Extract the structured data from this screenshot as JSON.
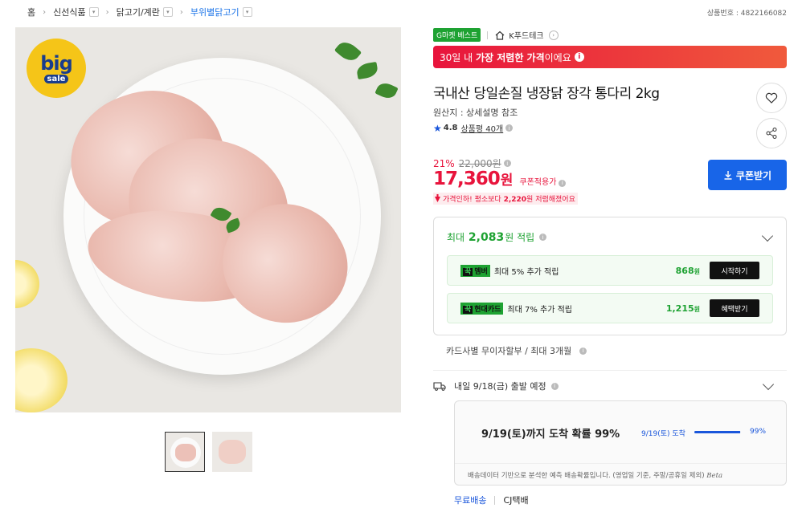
{
  "breadcrumb": [
    {
      "label": "홈"
    },
    {
      "label": "신선식품"
    },
    {
      "label": "닭고기/계란"
    },
    {
      "label": "부위별닭고기"
    }
  ],
  "product_no": "상품번호 : 4822166082",
  "gallery": {
    "badge_big": "big",
    "badge_sale": "sale",
    "thumbnail_count": 2
  },
  "seller": {
    "best_badge": "G마켓 베스트",
    "name": "K푸드테크"
  },
  "lowest_price": {
    "prefix": "30일 내 ",
    "highlight": "가장 저렴한 가격",
    "suffix": "이에요"
  },
  "product": {
    "title": "국내산 당일손질 냉장닭 장각 통다리 2kg",
    "origin": "원산지 : 상세설명 참조",
    "rating": "4.8",
    "reviews": "상품평 40개"
  },
  "price": {
    "discount_pct": "21%",
    "original": "22,000원",
    "sale_number": "17,360",
    "sale_unit": "원",
    "coupon_label": "쿠폰적용가",
    "drop_prefix": "가격인하! 평소보다 ",
    "drop_amount": "2,220",
    "drop_suffix": "원 저렴해졌어요",
    "coupon_button": "쿠폰받기"
  },
  "rewards": {
    "head_prefix": "최대 ",
    "head_amount": "2,083",
    "head_suffix": "원 적립",
    "rows": [
      {
        "tag_k": "꾹",
        "tag": "멤버",
        "text": "최대 5% 추가 적립",
        "amount": "868",
        "unit": "원",
        "button": "시작하기"
      },
      {
        "tag_k": "꾹",
        "tag": "현대카드",
        "text": "최대 7% 추가 적립",
        "amount": "1,215",
        "unit": "원",
        "button": "혜택받기"
      }
    ]
  },
  "installment": "카드사별 무이자할부 / 최대 3개월",
  "shipping": {
    "eta": "내일 9/18(금) 출발 예정",
    "predict_title": "9/19(토)까지 도착 확률 99%",
    "predict_date": "9/19(토) 도착",
    "predict_pct": "99%",
    "predict_progress": 0.99,
    "predict_note": "배송데이터 기반으로 분석한 예측 배송확률입니다. (영업일 기준, 주말/공휴일 제외)",
    "beta": "Beta",
    "free": "무료배송",
    "courier": "CJ택배"
  },
  "colors": {
    "accent_red": "#e8143c",
    "accent_blue": "#1865e8",
    "accent_green": "#1ea232"
  }
}
